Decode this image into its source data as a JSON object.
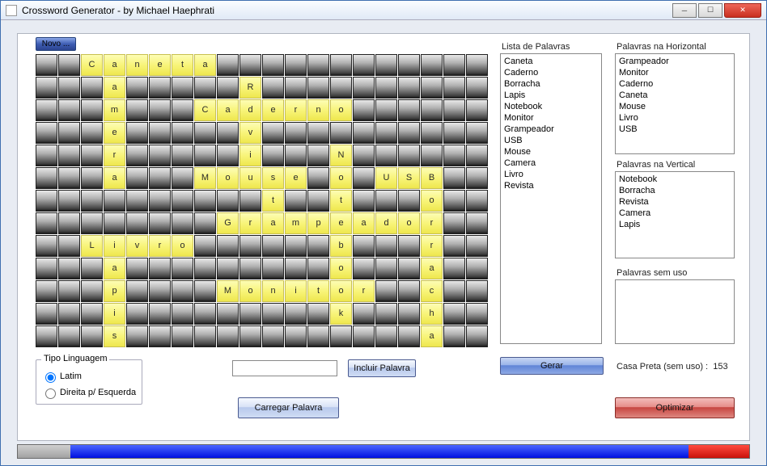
{
  "title": "Crossword Generator - by Michael Haephrati",
  "buttons": {
    "novo": "Novo ...",
    "incluir": "Incluir Palavra",
    "carregar": "Carregar Palavra",
    "gerar": "Gerar",
    "optimizar": "Optimizar"
  },
  "group_tipo": {
    "title": "Tipo Linguagem",
    "opt_latim": "Latim",
    "opt_rtl": "Direita p/ Esquerda"
  },
  "labels": {
    "lista": "Lista de Palavras",
    "horiz": "Palavras na Horizontal",
    "vert": "Palavras na Vertical",
    "semuso": "Palavras sem uso",
    "casa": "Casa Preta (sem uso)  :",
    "casa_val": "153"
  },
  "lists": {
    "palavras": [
      "Caneta",
      "Caderno",
      "Borracha",
      "Lapis",
      "Notebook",
      "Monitor",
      "Grampeador",
      "USB",
      "Mouse",
      "Camera",
      "Livro",
      "Revista"
    ],
    "horizontal": [
      "Grampeador",
      "Monitor",
      "Caderno",
      "Caneta",
      "Mouse",
      "Livro",
      "USB"
    ],
    "vertical": [
      "Notebook",
      "Borracha",
      "Revista",
      "Camera",
      "Lapis"
    ],
    "semuso": []
  },
  "grid": [
    "..Caneta............",
    "...a.....R..........",
    "...m...Caderno......",
    "...e.....v..........",
    "...r.....i...N......",
    "...a...Mouse.o.USB..",
    "..........t..t...o..",
    "........Grampeador..",
    "..Livro......b...r..",
    "...a.........o...a..",
    "...p....Monitor..c..",
    "...i.........k...h..",
    "...s.............a.."
  ]
}
